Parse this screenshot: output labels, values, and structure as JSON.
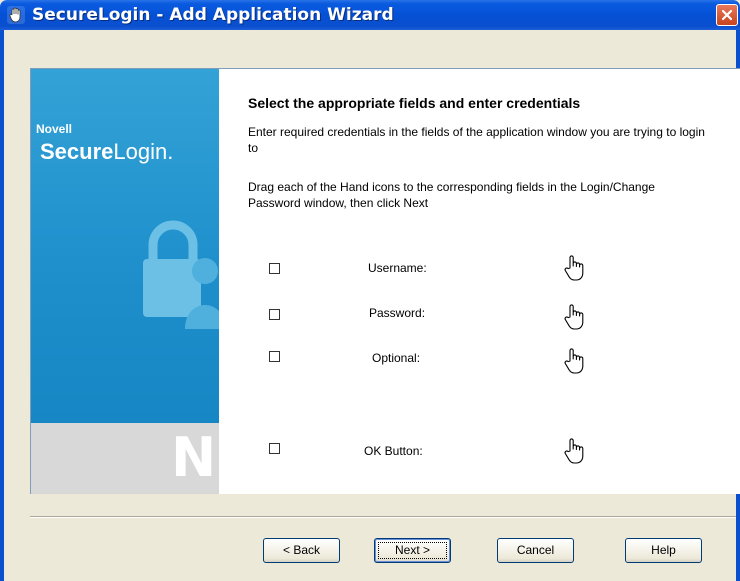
{
  "window": {
    "title": "SecureLogin - Add Application Wizard",
    "icon": "hand-icon",
    "close_icon": "close-x-icon",
    "accent": "#0a4fce"
  },
  "banner": {
    "company": "Novell",
    "product_bold": "Secure",
    "product_regular": "Login",
    "product_mark": ".",
    "logo_letter": "N",
    "color": "#1f90cc"
  },
  "main": {
    "heading": "Select the appropriate fields and enter credentials",
    "para1": "Enter required credentials in the fields of the application window you are trying to login to",
    "para2": "Drag each of the Hand icons to the corresponding fields in the Login/Change Password window, then click Next"
  },
  "fields": [
    {
      "label": "Username:",
      "checked": false,
      "icon": "hand-pointer-icon"
    },
    {
      "label": "Password:",
      "checked": false,
      "icon": "hand-pointer-icon"
    },
    {
      "label": "Optional:",
      "checked": false,
      "icon": "hand-pointer-icon"
    },
    {
      "label": "OK Button:",
      "checked": false,
      "icon": "hand-pointer-icon"
    }
  ],
  "buttons": {
    "back_label": "< Back",
    "next_label": "Next >",
    "cancel_label": "Cancel",
    "help_label": "Help"
  }
}
